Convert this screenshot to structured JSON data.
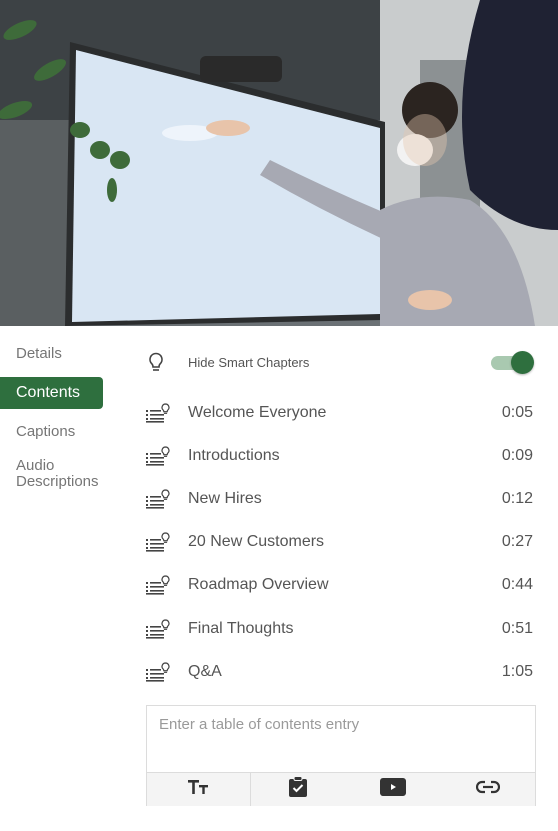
{
  "video": {
    "description": "Presenter pointing at a large display screen in a meeting room"
  },
  "sidebar": {
    "items": [
      {
        "label": "Details",
        "active": false
      },
      {
        "label": "Contents",
        "active": true
      },
      {
        "label": "Captions",
        "active": false
      },
      {
        "label": "Audio Descriptions",
        "active": false
      }
    ]
  },
  "smart_chapters": {
    "icon": "lightbulb-icon",
    "label": "Hide Smart Chapters",
    "toggle_on": true
  },
  "chapters": [
    {
      "title": "Welcome Everyone",
      "time": "0:05",
      "icon": "smart-chapter-icon"
    },
    {
      "title": "Introductions",
      "time": "0:09",
      "icon": "smart-chapter-icon"
    },
    {
      "title": "New Hires",
      "time": "0:12",
      "icon": "smart-chapter-icon"
    },
    {
      "title": "20 New Customers",
      "time": "0:27",
      "icon": "smart-chapter-icon"
    },
    {
      "title": "Roadmap Overview",
      "time": "0:44",
      "icon": "smart-chapter-icon"
    },
    {
      "title": "Final Thoughts",
      "time": "0:51",
      "icon": "smart-chapter-icon"
    },
    {
      "title": "Q&A",
      "time": "1:05",
      "icon": "smart-chapter-icon"
    }
  ],
  "editor": {
    "placeholder": "Enter a table of contents entry",
    "value": "",
    "tools": [
      "text-format-icon",
      "clipboard-check-icon",
      "video-play-icon",
      "link-icon"
    ]
  },
  "colors": {
    "accent": "#2e6f3e",
    "toggle_track": "#a9c9b0"
  }
}
